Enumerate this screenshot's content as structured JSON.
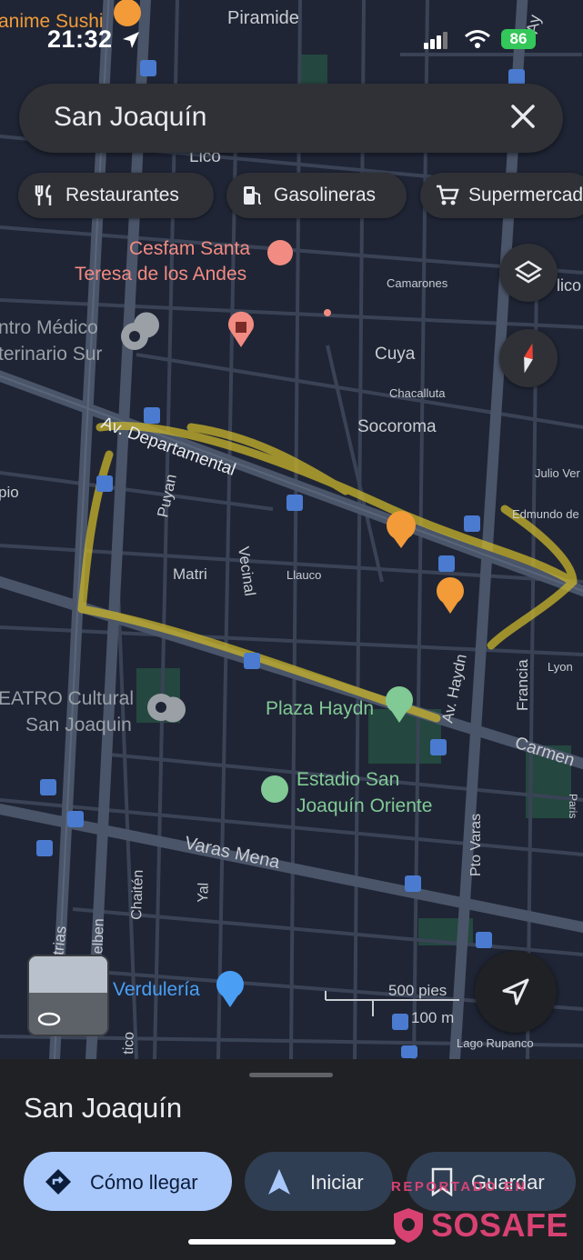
{
  "status_bar": {
    "time": "21:32",
    "battery": "86"
  },
  "search": {
    "query": "San Joaquín"
  },
  "chips": [
    {
      "label": "Restaurantes",
      "icon": "utensils-icon"
    },
    {
      "label": "Gasolineras",
      "icon": "gas-station-icon"
    },
    {
      "label": "Supermercados",
      "icon": "cart-icon"
    }
  ],
  "map": {
    "labels": {
      "sushi": "anime Sushi",
      "piramide": "Piramide",
      "cefam1": "Cesfam Santa",
      "cefam2": "Teresa de los Andes",
      "cmed1": "ntro Médico",
      "cmed2": "terinario Sur",
      "camarones": "Camarones",
      "cuya": "Cuya",
      "chacalluta": "Chacalluta",
      "socoroma": "Socoroma",
      "departamental": "Av. Departamental",
      "julioverne": "Julio Ver",
      "edmundo": "Edmundo de",
      "pio": "pio",
      "puyan": "Puyan",
      "matri": "Matri",
      "vecinal": "Vecinal",
      "llauco": "Llauco",
      "avhaydn": "Av. Haydn",
      "francia": "Francia",
      "lyon": "Lyon",
      "teatro1": "EATRO Cultural",
      "teatro2": "San Joaquin",
      "plaza": "Plaza Haydn",
      "carmen": "Carmen",
      "estadio1": "Estadio San",
      "estadio2": "Joaquín Oriente",
      "paris": "Paris",
      "varasmena": "Varas Mena",
      "ptovaras": "Pto Varas",
      "industrias": "Av. Industrias",
      "gelben": "Gelben",
      "chaiten": "Chaitén",
      "yal": "Yal",
      "verduleria": "Verdulería",
      "scale_ft": "500 pies",
      "scale_m": "100 m",
      "lagorupanco": "Lago Rupanco",
      "tico": "tico",
      "lico": "Lico",
      "ay": "Ay",
      "licol": "lico"
    },
    "colors": {
      "background": "#1f2535",
      "road": "#3a4356",
      "main_road": "#4a5569",
      "highlight": "#c9b42a",
      "poi_health": "#f28b82",
      "poi_food": "#f29b38",
      "park": "#81c995"
    }
  },
  "sheet": {
    "title": "San Joaquín",
    "buttons": [
      {
        "label": "Cómo llegar"
      },
      {
        "label": "Iniciar"
      },
      {
        "label": "Guardar"
      }
    ]
  },
  "watermark": {
    "line1": "REPORTADO EN",
    "line2": "SOSAFE"
  }
}
